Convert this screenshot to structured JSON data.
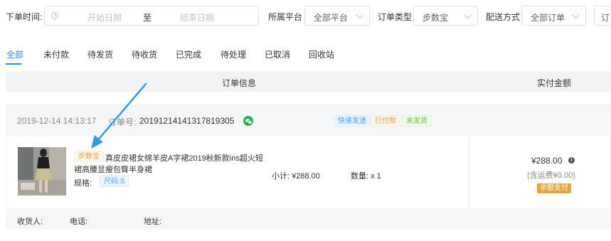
{
  "filters": {
    "order_time_label": "下单时间:",
    "start_placeholder": "开始日期",
    "range_sep": "至",
    "end_placeholder": "结束日期",
    "platform_label": "所属平台",
    "platform_value": "全部平台",
    "order_type_label": "订单类型",
    "order_type_value": "步数宝",
    "delivery_label": "配送方式",
    "delivery_value": "全部订单",
    "extra_button_label": "订"
  },
  "tabs": [
    "全部",
    "未付款",
    "待发货",
    "待收货",
    "已完成",
    "待处理",
    "已取消",
    "回收站"
  ],
  "active_tab": "全部",
  "table_header": {
    "order_info": "订单信息",
    "paid_amount": "实付金额"
  },
  "order": {
    "datetime": "2019-12-14 14:13:17",
    "order_no_label": "订单号:",
    "order_no": "20191214141317819305",
    "status_tags": {
      "delivery": "快递发送",
      "paid": "已付款",
      "shipping": "未发货"
    },
    "product": {
      "source_tag": "步数宝",
      "title_line1": "真皮皮裙女绵羊皮A字裙2019秋新款ins超火短",
      "title_line2": "裙高腰显瘦包臀半身裙",
      "spec_label": "规格:",
      "spec_value": "尺码:S",
      "subtotal": "小计: ¥288.00",
      "quantity": "数量: x 1"
    },
    "amount": "¥288.00",
    "shipping_note": "(含运费¥0.00)",
    "payment_method": "余额支付",
    "receiver_label": "收货人:",
    "phone_label": "电话:",
    "address_label": "地址:"
  },
  "colors": {
    "accent": "#1890ff",
    "arrow": "#2f9ae6",
    "wechat_green": "#2ab34a",
    "pay_badge": "#e6a23c"
  }
}
